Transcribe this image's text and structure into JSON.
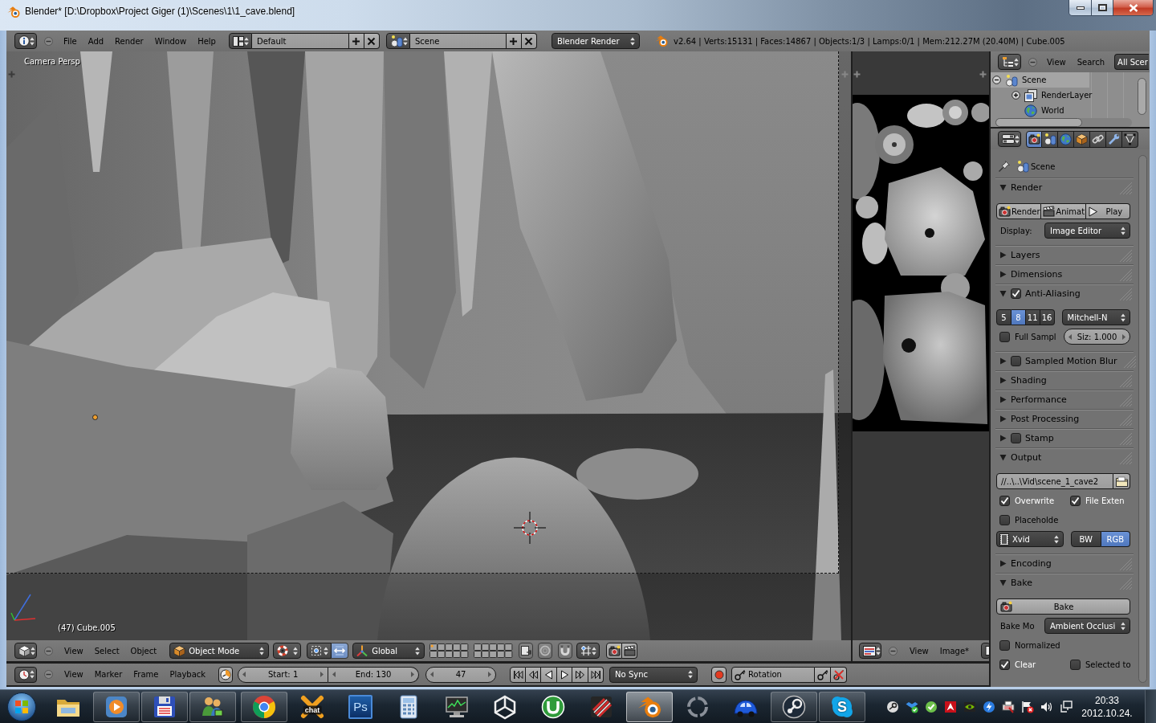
{
  "window": {
    "title": "Blender* [D:\\Dropbox\\Project Giger (1)\\Scenes\\1\\1_cave.blend]"
  },
  "info_header": {
    "menus": [
      "File",
      "Add",
      "Render",
      "Window",
      "Help"
    ],
    "screen_layout": "Default",
    "scene": "Scene",
    "render_engine": "Blender Render",
    "stats": "v2.64 | Verts:15131 | Faces:14867 | Objects:1/3 | Lamps:0/1 | Mem:212.27M (20.40M) | Cube.005"
  },
  "viewport": {
    "view_name": "Camera Persp",
    "object_label": "(47) Cube.005"
  },
  "viewport_header": {
    "menus": [
      "View",
      "Select",
      "Object"
    ],
    "mode": "Object Mode",
    "orientation": "Global"
  },
  "image_editor_header": {
    "menus": [
      "View",
      "Image*"
    ]
  },
  "timeline_header": {
    "menus": [
      "View",
      "Marker",
      "Frame",
      "Playback"
    ],
    "start": "Start: 1",
    "end": "End: 130",
    "current_frame": "47",
    "sync": "No Sync",
    "keying_set": "Rotation"
  },
  "outliner": {
    "menus": [
      "View",
      "Search"
    ],
    "display_mode": "All Scer",
    "tree": [
      {
        "kind": "scene",
        "label": "Scene",
        "selected": true,
        "expanded": true,
        "children": [
          {
            "kind": "render_layer",
            "label": "RenderLayer",
            "selected": false,
            "expanded": false
          },
          {
            "kind": "world",
            "label": "World",
            "selected": false
          }
        ]
      }
    ]
  },
  "properties": {
    "tabs": [
      {
        "selected": true
      },
      {
        "selected": false
      },
      {
        "selected": false
      },
      {
        "selected": false
      },
      {
        "selected": false
      },
      {
        "selected": false
      },
      {
        "selected": false
      }
    ],
    "context": "Scene",
    "panels": [
      {
        "title": "Render",
        "expanded": true,
        "rows": [
          {
            "cells": [
              {
                "kind": "button_group",
                "items": [
                  "Render",
                  "Animat",
                  "Play"
                ]
              }
            ]
          },
          {
            "cells": [
              {
                "kind": "label",
                "text": "Display:"
              },
              {
                "kind": "menu",
                "value": "Image Editor"
              }
            ]
          }
        ]
      },
      {
        "title": "Layers",
        "expanded": false
      },
      {
        "title": "Dimensions",
        "expanded": false
      },
      {
        "title": "Anti-Aliasing",
        "expanded": true,
        "checked": true,
        "rows": [
          {
            "cells": [
              {
                "kind": "segmented",
                "options": [
                  {
                    "label": "5",
                    "selected": false
                  },
                  {
                    "label": "8",
                    "selected": true
                  },
                  {
                    "label": "11",
                    "selected": false
                  },
                  {
                    "label": "16",
                    "selected": false
                  }
                ]
              },
              {
                "kind": "menu",
                "value": "Mitchell-N"
              }
            ]
          },
          {
            "cells": [
              {
                "kind": "checkbox",
                "label": "Full Sampl",
                "checked": false
              },
              {
                "kind": "number",
                "value": "Siz: 1.000"
              }
            ]
          }
        ]
      },
      {
        "title": "Sampled Motion Blur",
        "expanded": false,
        "checked": false
      },
      {
        "title": "Shading",
        "expanded": false
      },
      {
        "title": "Performance",
        "expanded": false
      },
      {
        "title": "Post Processing",
        "expanded": false
      },
      {
        "title": "Stamp",
        "expanded": false,
        "checked": false
      },
      {
        "title": "Output",
        "expanded": true,
        "rows": [
          {
            "cells": [
              {
                "kind": "path",
                "value": "//..\\..\\Vid\\scene_1_cave2"
              }
            ]
          },
          {
            "cells": [
              {
                "kind": "checkbox",
                "label": "Overwrite",
                "checked": true
              },
              {
                "kind": "checkbox",
                "label": "File Exten",
                "checked": true
              }
            ]
          },
          {
            "cells": [
              {
                "kind": "checkbox",
                "label": "Placeholde",
                "checked": false
              }
            ]
          },
          {
            "cells": [
              {
                "kind": "format",
                "value": "Xvid"
              },
              {
                "kind": "segmented",
                "options": [
                  {
                    "label": "BW",
                    "selected": false
                  },
                  {
                    "label": "RGB",
                    "selected": true
                  }
                ]
              }
            ]
          }
        ]
      },
      {
        "title": "Encoding",
        "expanded": false
      },
      {
        "title": "Bake",
        "expanded": true,
        "rows": [
          {
            "cells": [
              {
                "kind": "button",
                "label": "Bake"
              }
            ]
          },
          {
            "cells": [
              {
                "kind": "label",
                "text": "Bake Mo"
              },
              {
                "kind": "menu",
                "value": "Ambient Occlusi"
              }
            ]
          },
          {
            "cells": [
              {
                "kind": "checkbox",
                "label": "Normalized",
                "checked": false
              }
            ]
          },
          {
            "cells": [
              {
                "kind": "checkbox",
                "label": "Clear",
                "checked": true
              },
              {
                "kind": "checkbox",
                "label": "Selected to",
                "checked": false
              }
            ]
          }
        ]
      }
    ]
  },
  "taskbar": {
    "apps": [
      {
        "running": false,
        "selected": false
      },
      {
        "running": true,
        "selected": false
      },
      {
        "running": true,
        "selected": false
      },
      {
        "running": true,
        "selected": false
      },
      {
        "running": true,
        "selected": false
      },
      {
        "running": false,
        "selected": false,
        "label": "chat"
      },
      {
        "running": false,
        "selected": false,
        "label": "Ps"
      },
      {
        "running": false,
        "selected": false
      },
      {
        "running": false,
        "selected": false
      },
      {
        "running": false,
        "selected": false
      },
      {
        "running": false,
        "selected": false
      },
      {
        "running": false,
        "selected": false
      },
      {
        "running": true,
        "selected": true
      },
      {
        "running": false,
        "selected": false
      },
      {
        "running": false,
        "selected": false
      },
      {
        "running": true,
        "selected": false
      },
      {
        "running": true,
        "selected": false,
        "label": "S"
      }
    ],
    "time": "20:33",
    "date": "2012.10.24."
  }
}
